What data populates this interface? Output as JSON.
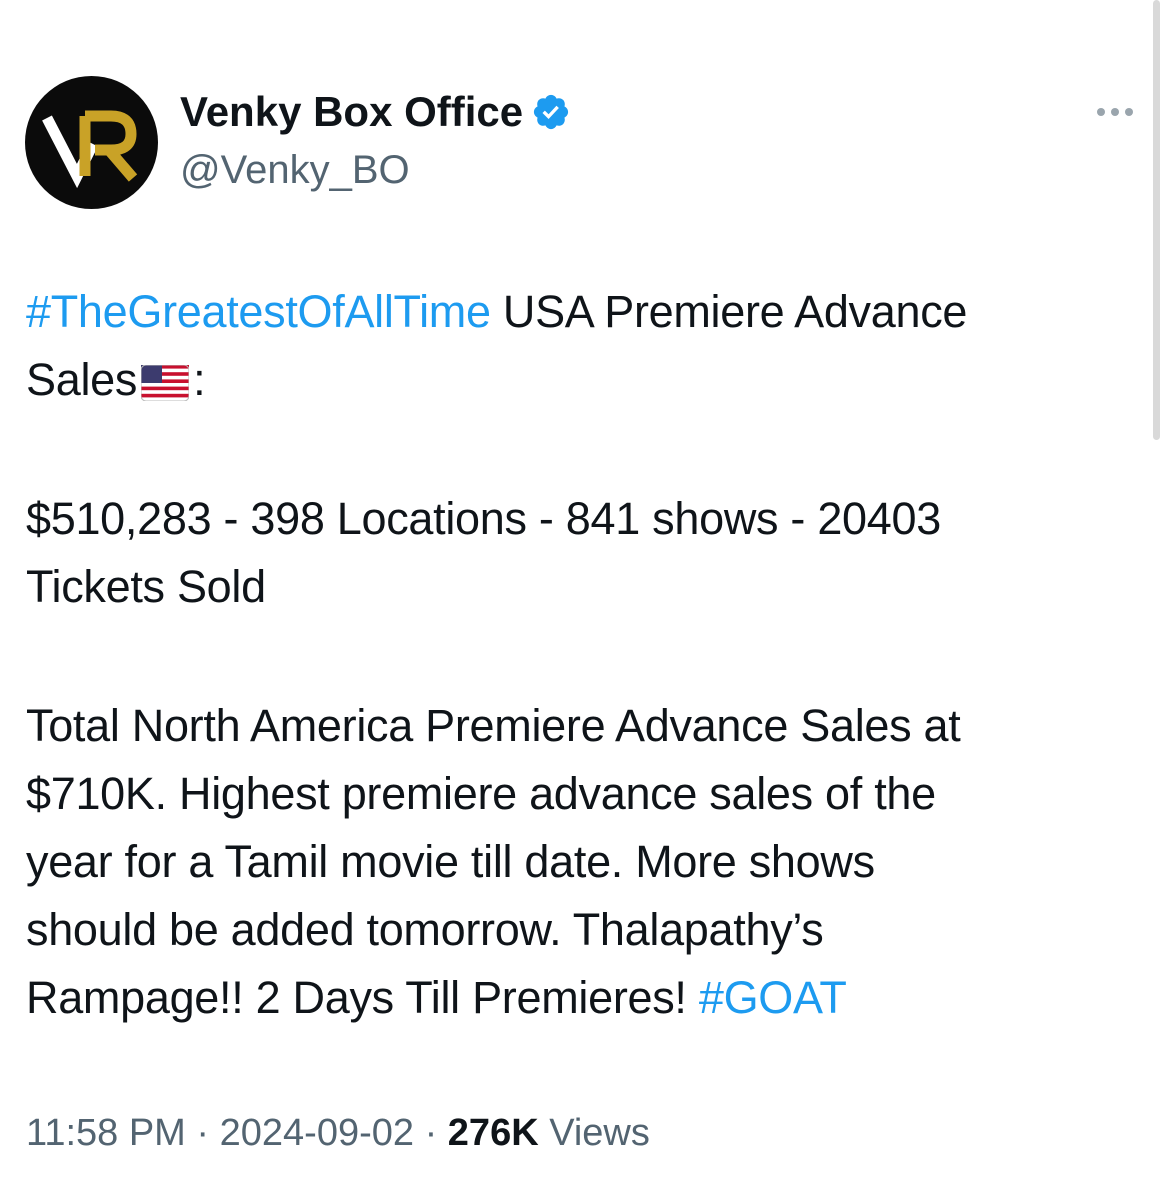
{
  "account": {
    "display_name": "Venky Box Office",
    "handle": "@Venky_BO",
    "verified": true,
    "avatar_icon": "vr-logo-icon",
    "avatar_colors": {
      "background": "#0b0b0b",
      "v": "#ffffff",
      "r": "#c9a227"
    }
  },
  "tweet": {
    "p1_hashtag": "#TheGreatestOfAllTime",
    "p1_text_a": " USA Premiere Advance",
    "p1_text_b": "Sales",
    "p1_text_c": ":",
    "p1_emoji": "us-flag-emoji",
    "p2_line1": "$510,283 - 398 Locations - 841 shows - 20403",
    "p2_line2": "Tickets Sold",
    "p3_line1": "Total North America Premiere Advance Sales at",
    "p3_line2": "$710K. Highest premiere advance sales of the",
    "p3_line3": "year for a Tamil movie till date. More shows",
    "p3_line4": "should be added tomorrow. Thalapathy’s",
    "p3_line5": "Rampage!! 2 Days Till Premieres! ",
    "p3_hashtag": "#GOAT"
  },
  "meta": {
    "time": "11:58 PM",
    "separator": " · ",
    "date": "2024-09-02",
    "views_count": "276K",
    "views_label": " Views"
  },
  "colors": {
    "hashtag": "#1d9bf0",
    "verified": "#1d9bf0",
    "secondary_text": "#536471",
    "primary_text": "#0f1419"
  }
}
